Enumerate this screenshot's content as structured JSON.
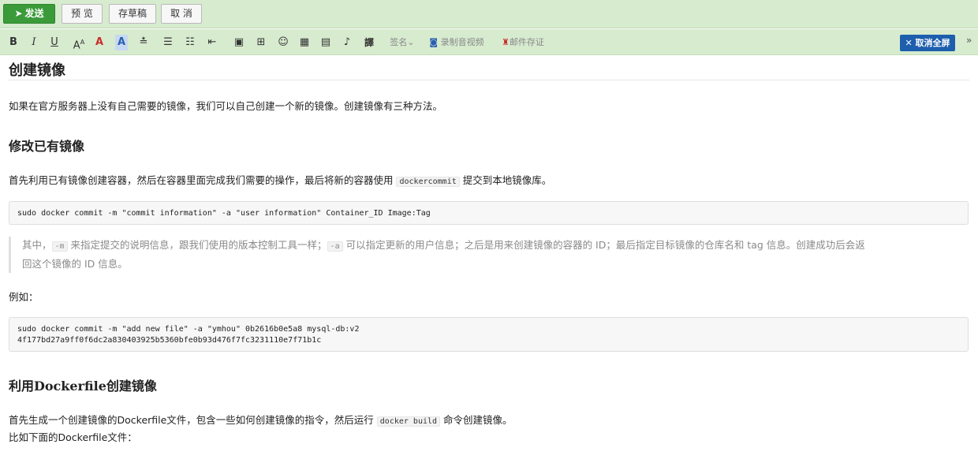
{
  "actions": {
    "send": "发送",
    "preview": "预 览",
    "draft": "存草稿",
    "cancel": "取 消"
  },
  "toolbar": {
    "bold": "B",
    "italic": "I",
    "underline": "U",
    "font_size": "A",
    "font_color": "A",
    "bg_color": "A",
    "strike": "≛",
    "align": "☰",
    "list": "☷",
    "indent": "⇤",
    "image": "▣",
    "table": "⊞",
    "emoji": "☺",
    "attach": "▦",
    "calendar": "▤",
    "mic": "♪",
    "translate": "譯",
    "signature": "签名",
    "record": "录制音视频",
    "mail_save": "邮件存证",
    "fullscreen": "取消全屏",
    "collapse": "»"
  },
  "content": {
    "title": "创建镜像",
    "intro": "如果在官方服务器上没有自己需要的镜像，我们可以自己创建一个新的镜像。创建镜像有三种方法。",
    "section1_title": "修改已有镜像",
    "section1_p1_a": "首先利用已有镜像创建容器，然后在容器里面完成我们需要的操作，最后将新的容器使用 ",
    "section1_p1_code": "dockercommit",
    "section1_p1_b": " 提交到本地镜像库。",
    "code1": "sudo docker commit -m \"commit information\" -a \"user information\" Container_ID Image:Tag",
    "quote_a": "其中，",
    "quote_code1": "-m",
    "quote_b": " 来指定提交的说明信息，跟我们使用的版本控制工具一样；",
    "quote_code2": "-a",
    "quote_c": " 可以指定更新的用户信息；之后是用来创建镜像的容器的 ID；最后指定目标镜像的仓库名和 tag 信息。创建成功后会返",
    "quote_d": "回这个镜像的 ID 信息。",
    "example_label": "例如：",
    "code2_line1": "sudo docker commit -m \"add new file\" -a \"ymhou\" 0b2616b0e5a8 mysql-db:v2",
    "code2_line2": "4f177bd27a9ff0f6dc2a830403925b5360bfe0b93d476f7fc3231110e7f71b1c",
    "section2_title": "利用Dockerfile创建镜像",
    "section2_p1_a": "首先生成一个创建镜像的Dockerfile文件，包含一些如何创建镜像的指令，然后运行 ",
    "section2_p1_code": "docker build",
    "section2_p1_b": " 命令创建镜像。",
    "section2_p2": "比如下面的Dockerfile文件："
  },
  "colors": {
    "toolbar_bg": "#d7ebcf",
    "send_button": "#3b9b3a",
    "fullscreen_button": "#1d5fad"
  }
}
